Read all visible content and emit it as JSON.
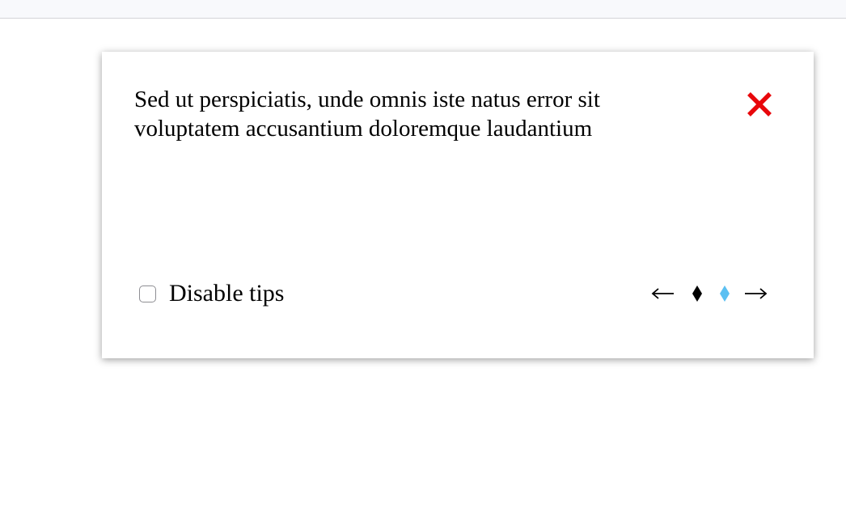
{
  "tip": {
    "text": "Sed ut perspiciatis, unde omnis iste natus error sit voluptatem accusantium doloremque laudantium"
  },
  "close": {
    "icon": "close-icon",
    "color": "#e8070b"
  },
  "disable_tips": {
    "label": "Disable tips",
    "checked": false
  },
  "pager": {
    "prev_icon": "arrow-left-icon",
    "next_icon": "arrow-right-icon",
    "dots": [
      {
        "state": "inactive",
        "color": "#000000"
      },
      {
        "state": "active",
        "color": "#5bc0f2"
      }
    ]
  }
}
